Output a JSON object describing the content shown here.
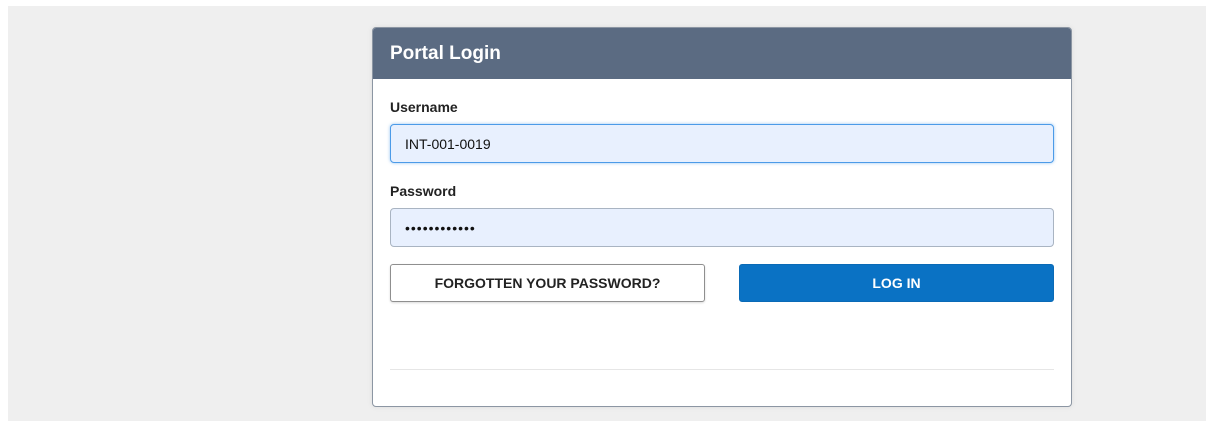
{
  "login": {
    "title": "Portal Login",
    "username": {
      "label": "Username",
      "value": "INT-001-0019"
    },
    "password": {
      "label": "Password",
      "value": "••••••••••••"
    },
    "forgot_label": "FORGOTTEN YOUR PASSWORD?",
    "login_label": "LOG IN"
  },
  "colors": {
    "header": "#5b6b82",
    "primary_button": "#0a72c4",
    "input_fill": "#e8f0fe",
    "page_background": "#efefef"
  }
}
